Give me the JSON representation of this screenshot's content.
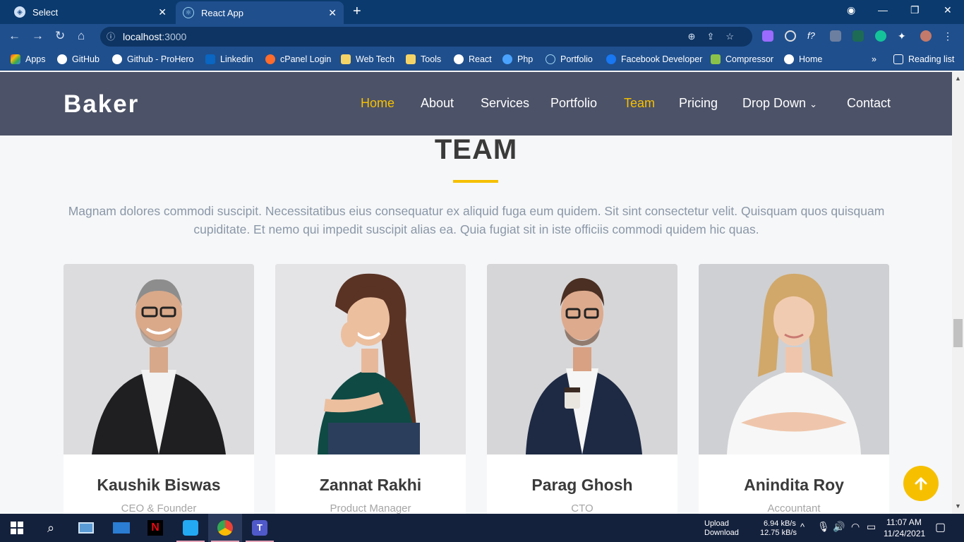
{
  "browser": {
    "tabs": [
      {
        "title": "Select",
        "active": false
      },
      {
        "title": "React App",
        "active": true
      }
    ],
    "address": {
      "host": "localhost",
      "port": ":3000"
    },
    "bookmarks": [
      {
        "label": "Apps",
        "icon": "apps-grid-icon"
      },
      {
        "label": "GitHub",
        "icon": "github-icon"
      },
      {
        "label": "Github - ProHero",
        "icon": "github-icon"
      },
      {
        "label": "Linkedin",
        "icon": "linkedin-icon"
      },
      {
        "label": "cPanel Login",
        "icon": "cpanel-icon"
      },
      {
        "label": "Web Tech",
        "icon": "folder-icon"
      },
      {
        "label": "Tools",
        "icon": "folder-icon"
      },
      {
        "label": "React",
        "icon": "github-icon"
      },
      {
        "label": "Php",
        "icon": "cloud-icon"
      },
      {
        "label": "Portfolio",
        "icon": "react-icon"
      },
      {
        "label": "Facebook Developer",
        "icon": "facebook-icon"
      },
      {
        "label": "Compressor",
        "icon": "compressor-icon"
      },
      {
        "label": "Home",
        "icon": "chrome-icon"
      }
    ],
    "reading_list": "Reading list",
    "more_bookmarks": "»"
  },
  "site": {
    "brand": "Baker",
    "nav": [
      {
        "label": "Home",
        "active": true
      },
      {
        "label": "About",
        "active": false
      },
      {
        "label": "Services",
        "active": false
      },
      {
        "label": "Portfolio",
        "active": false
      },
      {
        "label": "Team",
        "active": true
      },
      {
        "label": "Pricing",
        "active": false
      },
      {
        "label": "Drop Down",
        "active": false
      },
      {
        "label": "Contact",
        "active": false
      }
    ],
    "section": {
      "title": "TEAM",
      "description": "Magnam dolores commodi suscipit. Necessitatibus eius consequatur ex aliquid fuga eum quidem. Sit sint consectetur velit. Quisquam quos quisquam cupiditate. Et nemo qui impedit suscipit alias ea. Quia fugiat sit in iste officiis commodi quidem hic quas."
    },
    "team": [
      {
        "name": "Kaushik Biswas",
        "role": "CEO & Founder"
      },
      {
        "name": "Zannat Rakhi",
        "role": "Product Manager"
      },
      {
        "name": "Parag Ghosh",
        "role": "CTO"
      },
      {
        "name": "Anindita Roy",
        "role": "Accountant"
      }
    ]
  },
  "taskbar": {
    "net_labels": {
      "upload": "Upload",
      "download": "Download"
    },
    "net_values": {
      "upload": "6.94 kB/s",
      "download": "12.75 kB/s"
    },
    "time": "11:07 AM",
    "date": "11/24/2021"
  },
  "colors": {
    "accent": "#f6c000",
    "header_bg": "#4c5267",
    "chrome_bg": "#1f4f8d"
  }
}
